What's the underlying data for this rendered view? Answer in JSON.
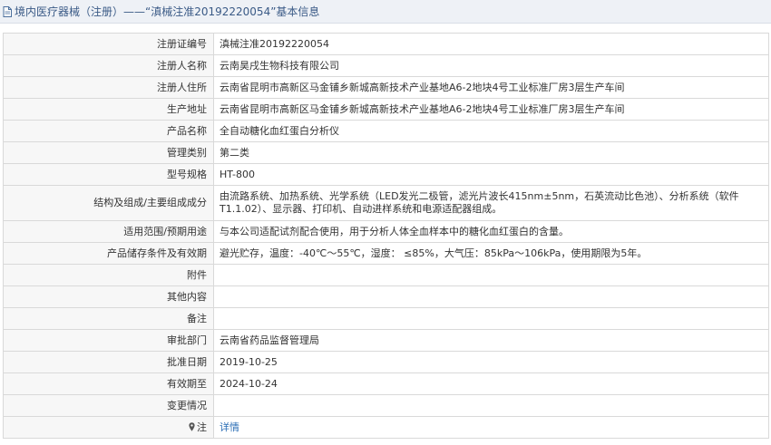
{
  "header": {
    "title": "境内医疗器械（注册）——“滇械注准20192220054”基本信息"
  },
  "rows": [
    {
      "label": "注册证编号",
      "value": "滇械注准20192220054"
    },
    {
      "label": "注册人名称",
      "value": "云南昊戌生物科技有限公司"
    },
    {
      "label": "注册人住所",
      "value": "云南省昆明市高新区马金铺乡新城高新技术产业基地A6-2地块4号工业标准厂房3层生产车间"
    },
    {
      "label": "生产地址",
      "value": "云南省昆明市高新区马金铺乡新城高新技术产业基地A6-2地块4号工业标准厂房3层生产车间"
    },
    {
      "label": "产品名称",
      "value": "全自动糖化血红蛋白分析仪"
    },
    {
      "label": "管理类别",
      "value": "第二类"
    },
    {
      "label": "型号规格",
      "value": "HT-800"
    },
    {
      "label": "结构及组成/主要组成成分",
      "value": "由流路系统、加热系统、光学系统（LED发光二极管，滤光片波长415nm±5nm，石英流动比色池）、分析系统（软件T1.1.02）、显示器、打印机、自动进样系统和电源适配器组成。"
    },
    {
      "label": "适用范围/预期用途",
      "value": "与本公司适配试剂配合使用，用于分析人体全血样本中的糖化血红蛋白的含量。"
    },
    {
      "label": "产品储存条件及有效期",
      "value": "避光贮存，温度：-40℃～55℃，湿度： ≤85%，大气压：85kPa～106kPa，使用期限为5年。"
    },
    {
      "label": "附件",
      "value": ""
    },
    {
      "label": "其他内容",
      "value": ""
    },
    {
      "label": "备注",
      "value": ""
    },
    {
      "label": "审批部门",
      "value": "云南省药品监督管理局"
    },
    {
      "label": "批准日期",
      "value": "2019-10-25"
    },
    {
      "label": "有效期至",
      "value": "2024-10-24"
    },
    {
      "label": "变更情况",
      "value": ""
    }
  ],
  "note_row": {
    "label": "注",
    "link_text": "详情"
  },
  "icons": {
    "title_icon": "document-icon",
    "note_icon": "map-pin-icon"
  }
}
